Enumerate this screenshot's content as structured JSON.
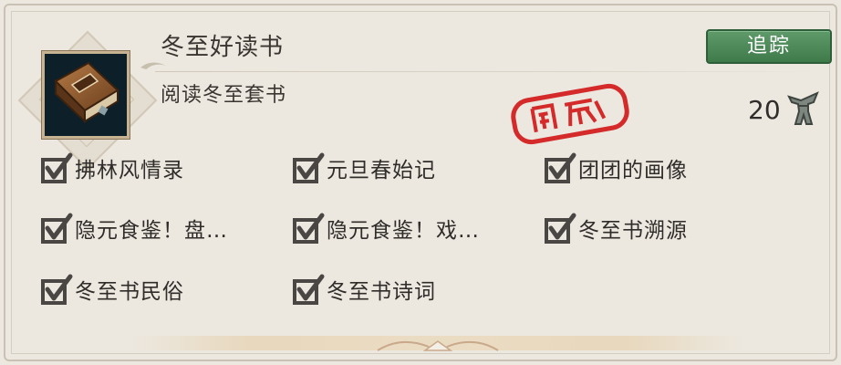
{
  "quest": {
    "title": "冬至好读书",
    "subtitle": "阅读冬至套书",
    "track_button": "追踪",
    "reward_count": "20",
    "reward_icon": "bronze-drinking-vessel-icon",
    "item_icon": "leather-book-icon",
    "completed_stamp": "completed-seal-stamp"
  },
  "checklist": [
    {
      "label": "拂林风情录",
      "checked": true
    },
    {
      "label": "元旦春始记",
      "checked": true
    },
    {
      "label": "团团的画像",
      "checked": true
    },
    {
      "label": "隐元食鉴！盘…",
      "checked": true
    },
    {
      "label": "隐元食鉴！戏…",
      "checked": true
    },
    {
      "label": "冬至书溯源",
      "checked": true
    },
    {
      "label": "冬至书民俗",
      "checked": true
    },
    {
      "label": "冬至书诗词",
      "checked": true
    }
  ],
  "colors": {
    "accent_green": "#4a8757",
    "stamp_red": "#d42a2a",
    "text": "#2f2c29",
    "panel": "#ece8e0"
  }
}
